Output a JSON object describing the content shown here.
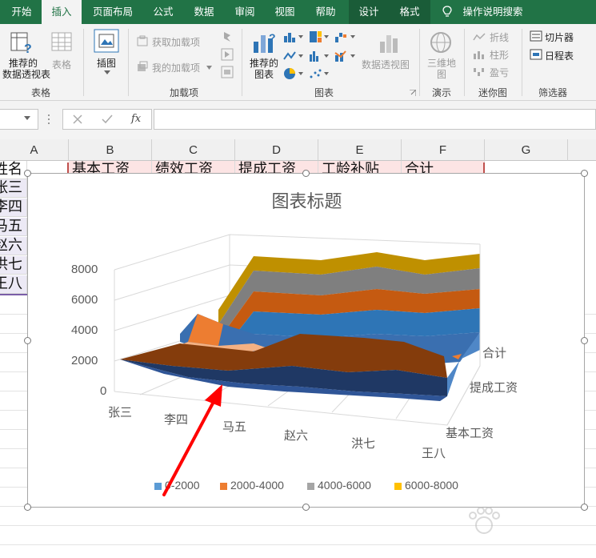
{
  "ribbon_tabs": [
    "开始",
    "插入",
    "页面布局",
    "公式",
    "数据",
    "审阅",
    "视图",
    "帮助",
    "设计",
    "格式"
  ],
  "active_tab": "插入",
  "tell_me": "操作说明搜索",
  "ribbon": {
    "tables_group": {
      "label": "表格",
      "pivot": "推荐的\n数据透视表",
      "table": "表格"
    },
    "illustrations": {
      "label": "插图"
    },
    "addins_group": {
      "label": "加载项",
      "get": "获取加载项",
      "mine": "我的加载项"
    },
    "charts_group": {
      "label": "图表",
      "recommended": "推荐的\n图表",
      "pivot_chart": "数据透视图"
    },
    "tours_group": {
      "label": "演示",
      "map3d": "三维地\n图"
    },
    "sparklines_group": {
      "label": "迷你图",
      "line": "折线",
      "column": "柱形",
      "winloss": "盈亏"
    },
    "filters_group": {
      "label": "筛选器",
      "slicer": "切片器",
      "timeline": "日程表"
    }
  },
  "formula_bar": {
    "fx": "fx"
  },
  "sheet": {
    "columns": [
      "A",
      "B",
      "C",
      "D",
      "E",
      "F",
      "G"
    ],
    "header_row": [
      "姓名",
      "基本工资",
      "绩效工资",
      "提成工资",
      "工龄补贴",
      "合计"
    ],
    "names": [
      "张三",
      "李四",
      "马五",
      "赵六",
      "洪七",
      "王八"
    ]
  },
  "chart_data": {
    "type": "surface-3d",
    "title": "图表标题",
    "categories": [
      "张三",
      "李四",
      "马五",
      "赵六",
      "洪七",
      "王八"
    ],
    "series": [
      "基本工资",
      "提成工资",
      "合计"
    ],
    "z_ticks": [
      "0",
      "2000",
      "4000",
      "6000",
      "8000"
    ],
    "z_range": [
      0,
      8000
    ],
    "legend": [
      {
        "label": "0-2000",
        "color": "#5b9bd5"
      },
      {
        "label": "2000-4000",
        "color": "#ed7d31"
      },
      {
        "label": "4000-6000",
        "color": "#a5a5a5"
      },
      {
        "label": "6000-8000",
        "color": "#ffc000"
      }
    ],
    "legend_position": "bottom"
  },
  "annotation": {
    "type": "red-arrow",
    "color": "#ff0000"
  }
}
